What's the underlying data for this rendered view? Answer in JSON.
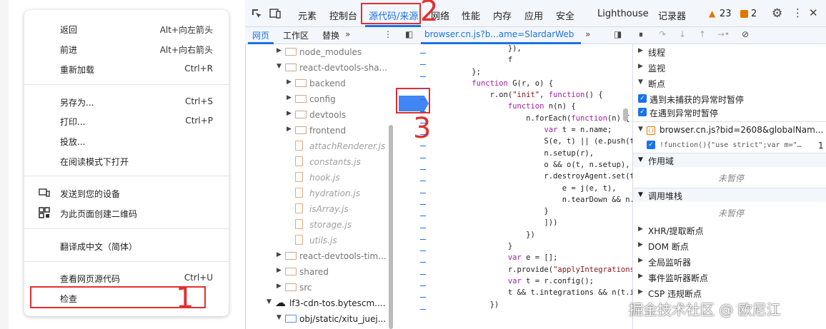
{
  "context_menu": {
    "items": [
      {
        "label": "返回",
        "shortcut": "Alt+向左箭头"
      },
      {
        "label": "前进",
        "shortcut": "Alt+向右箭头"
      },
      {
        "label": "重新加载",
        "shortcut": "Ctrl+R"
      },
      {
        "label": "另存为...",
        "shortcut": "Ctrl+S"
      },
      {
        "label": "打印...",
        "shortcut": "Ctrl+P"
      },
      {
        "label": "投放...",
        "shortcut": ""
      },
      {
        "label": "在阅读模式下打开",
        "shortcut": ""
      },
      {
        "label": "发送到您的设备",
        "shortcut": ""
      },
      {
        "label": "为此页面创建二维码",
        "shortcut": ""
      },
      {
        "label": "翻译成中文（简体）",
        "shortcut": ""
      },
      {
        "label": "查看网页源代码",
        "shortcut": "Ctrl+U"
      },
      {
        "label": "检查",
        "shortcut": ""
      }
    ]
  },
  "annotations": {
    "n1": "1",
    "n2": "2",
    "n3": "3"
  },
  "devtools": {
    "tabs": [
      "元素",
      "控制台",
      "源代码/来源",
      "网络",
      "性能",
      "内存",
      "应用",
      "安全",
      "Lighthouse",
      "记录器"
    ],
    "warn_count": "23",
    "issue_count": "2",
    "nav_tabs": [
      "网页",
      "工作区",
      "替换"
    ],
    "file_tab": "browser.cn.js?b...ame=SlardarWeb",
    "tree": [
      {
        "name": "node_modules",
        "kind": "folder",
        "indent": 1,
        "arrow": "▶"
      },
      {
        "name": "react-devtools-sha...",
        "kind": "folder",
        "indent": 1,
        "arrow": "▼"
      },
      {
        "name": "backend",
        "kind": "folder",
        "indent": 2,
        "arrow": "▶"
      },
      {
        "name": "config",
        "kind": "folder",
        "indent": 2,
        "arrow": "▶"
      },
      {
        "name": "devtools",
        "kind": "folder",
        "indent": 2,
        "arrow": "▶"
      },
      {
        "name": "frontend",
        "kind": "folder",
        "indent": 2,
        "arrow": "▶"
      },
      {
        "name": "attachRenderer.js",
        "kind": "file",
        "indent": 2,
        "arrow": ""
      },
      {
        "name": "constants.js",
        "kind": "file",
        "indent": 2,
        "arrow": ""
      },
      {
        "name": "hook.js",
        "kind": "file",
        "indent": 2,
        "arrow": ""
      },
      {
        "name": "hydration.js",
        "kind": "file",
        "indent": 2,
        "arrow": ""
      },
      {
        "name": "isArray.js",
        "kind": "file",
        "indent": 2,
        "arrow": ""
      },
      {
        "name": "storage.js",
        "kind": "file",
        "indent": 2,
        "arrow": ""
      },
      {
        "name": "utils.js",
        "kind": "file",
        "indent": 2,
        "arrow": ""
      },
      {
        "name": "react-devtools-tim...",
        "kind": "folder",
        "indent": 1,
        "arrow": "▶"
      },
      {
        "name": "shared",
        "kind": "folder",
        "indent": 1,
        "arrow": "▶"
      },
      {
        "name": "src",
        "kind": "folder",
        "indent": 1,
        "arrow": "▶"
      },
      {
        "name": "lf3-cdn-tos.bytescm....",
        "kind": "cloud",
        "indent": 0,
        "arrow": "▼"
      },
      {
        "name": "obj/static/xitu_juej...",
        "kind": "folder",
        "indent": 1,
        "arrow": "▼"
      }
    ],
    "code_lines": [
      "            }),",
      "            f",
      "    };",
      "    function G(r, o) {",
      "        r.on(\"init\", function() {",
      "            function n(n) {",
      "                n.forEach(function(n) {",
      "                    var t = n.name;",
      "                    S(e, t) || (e.push(t),",
      "                    n.setup(r),",
      "                    o && o(t, n.setup),",
      "                    r.destroyAgent.set(t,",
      "                        e = j(e, t),",
      "                        n.tearDown && n.te",
      "                    }",
      "                    ]))",
      "                })",
      "            }",
      "            var e = [];",
      "            r.provide(\"applyIntegrations\",",
      "            var t = r.config();",
      "            t && t.integrations && n(t.int",
      "        })"
    ],
    "right_panel": {
      "threads": "线程",
      "watch": "监视",
      "breakpoints": "断点",
      "bp_uncaught": "遇到未捕获的异常时暂停",
      "bp_caught": "在遇到异常时暂停",
      "bp_file": "browser.cn.js?bid=2608&globalNam...",
      "bp_code": "!function(){\"use strict\";var m=\"…",
      "bp_line": "1",
      "scope": "作用域",
      "not_paused_1": "未暂停",
      "callstack": "调用堆栈",
      "not_paused_2": "未暂停",
      "xhr": "XHR/提取断点",
      "dom": "DOM 断点",
      "global": "全局监听器",
      "event": "事件监听器断点",
      "csp": "CSP 违规断点"
    },
    "watermark": "掘金技术社区 @ 欧尼江"
  },
  "colors": {
    "accent": "#1a73e8",
    "annotation": "#e0302f"
  }
}
